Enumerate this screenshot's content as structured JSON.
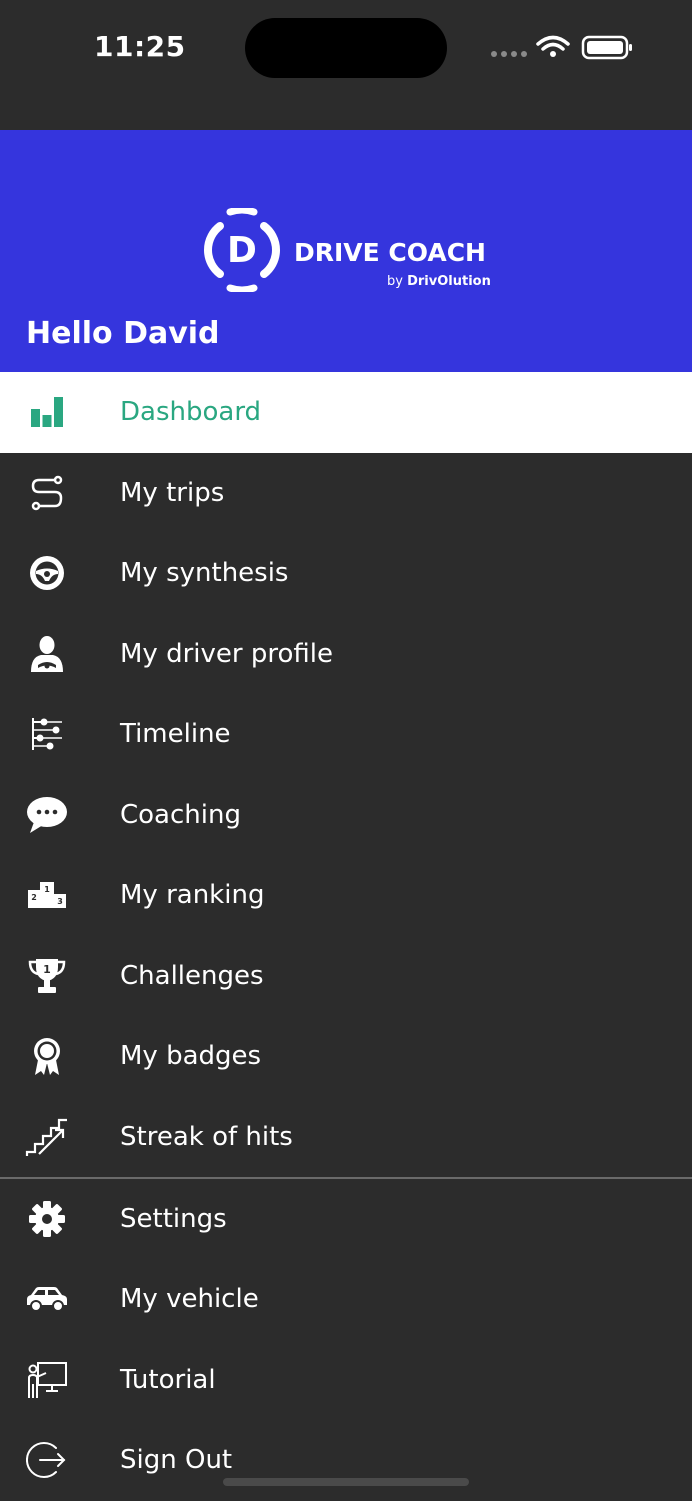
{
  "status_bar": {
    "time": "11:25"
  },
  "header": {
    "logo_title": "DRIVE COACH",
    "logo_by": "by",
    "logo_brand": "DrivOlution",
    "logo_letter": "D",
    "greeting": "Hello David",
    "background_color": "#3535dd"
  },
  "menu": {
    "active_color": "#2aa781",
    "items": [
      {
        "label": "Dashboard",
        "icon": "bar-chart-icon"
      },
      {
        "label": "My trips",
        "icon": "route-icon"
      },
      {
        "label": "My synthesis",
        "icon": "steering-wheel-icon"
      },
      {
        "label": "My driver profile",
        "icon": "driver-icon"
      },
      {
        "label": "Timeline",
        "icon": "timeline-icon"
      },
      {
        "label": "Coaching",
        "icon": "chat-bubble-icon"
      },
      {
        "label": "My ranking",
        "icon": "podium-icon"
      },
      {
        "label": "Challenges",
        "icon": "trophy-icon"
      },
      {
        "label": "My badges",
        "icon": "badge-icon"
      },
      {
        "label": "Streak of hits",
        "icon": "stairs-icon"
      }
    ],
    "secondary_items": [
      {
        "label": "Settings",
        "icon": "gear-icon"
      },
      {
        "label": "My vehicle",
        "icon": "car-icon"
      },
      {
        "label": "Tutorial",
        "icon": "presentation-icon"
      },
      {
        "label": "Sign Out",
        "icon": "sign-out-icon"
      }
    ]
  }
}
